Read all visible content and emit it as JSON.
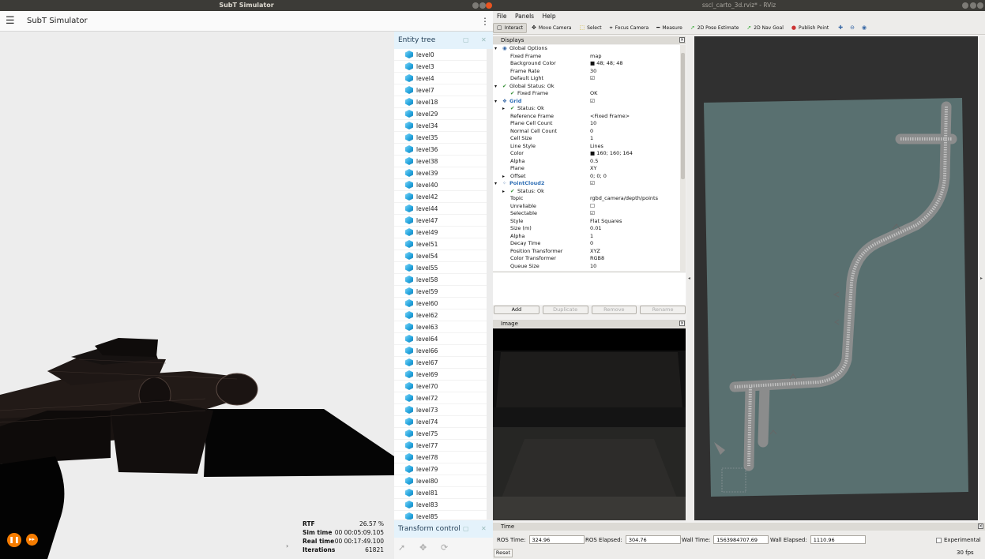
{
  "sim": {
    "window_title": "SubT Simulator",
    "app_title": "SubT Simulator",
    "menu_icon": "hamburger-menu-icon",
    "overflow_icon": "kebab-menu-icon",
    "entity_tree": {
      "title": "Entity tree",
      "items": [
        "level0",
        "level3",
        "level4",
        "level7",
        "level18",
        "level29",
        "level34",
        "level35",
        "level36",
        "level38",
        "level39",
        "level40",
        "level42",
        "level44",
        "level47",
        "level49",
        "level51",
        "level54",
        "level55",
        "level58",
        "level59",
        "level60",
        "level62",
        "level63",
        "level64",
        "level66",
        "level67",
        "level69",
        "level70",
        "level72",
        "level73",
        "level74",
        "level75",
        "level77",
        "level78",
        "level79",
        "level80",
        "level81",
        "level83",
        "level85"
      ]
    },
    "transform_control": {
      "title": "Transform control"
    },
    "stats": [
      {
        "label": "RTF",
        "value": "26.57 %"
      },
      {
        "label": "Sim time",
        "value": "00 00:05:09.105"
      },
      {
        "label": "Real time",
        "value": "00 00:17:49.100"
      },
      {
        "label": "Iterations",
        "value": "61821"
      }
    ],
    "accent_color": "#f57c00"
  },
  "rviz": {
    "window_title": "sscl_carto_3d.rviz* - RViz",
    "menu": [
      "File",
      "Panels",
      "Help"
    ],
    "toolbar": [
      {
        "label": "Interact",
        "icon": "interact-icon",
        "active": true
      },
      {
        "label": "Move Camera",
        "icon": "move-camera-icon",
        "active": false
      },
      {
        "label": "Select",
        "icon": "select-icon",
        "active": false
      },
      {
        "label": "Focus Camera",
        "icon": "focus-camera-icon",
        "active": false
      },
      {
        "label": "Measure",
        "icon": "measure-icon",
        "active": false
      },
      {
        "label": "2D Pose Estimate",
        "icon": "pose-estimate-icon",
        "active": false
      },
      {
        "label": "2D Nav Goal",
        "icon": "nav-goal-icon",
        "active": false
      },
      {
        "label": "Publish Point",
        "icon": "publish-point-icon",
        "active": false
      }
    ],
    "displays": {
      "title": "Displays",
      "rows": [
        {
          "indent": 0,
          "arrow": "▾",
          "icon": "◉",
          "name": "Global Options",
          "value": "",
          "blue": false
        },
        {
          "indent": 1,
          "arrow": "",
          "icon": "",
          "name": "Fixed Frame",
          "value": "map",
          "blue": false
        },
        {
          "indent": 1,
          "arrow": "",
          "icon": "",
          "name": "Background Color",
          "value": "■ 48; 48; 48",
          "blue": false
        },
        {
          "indent": 1,
          "arrow": "",
          "icon": "",
          "name": "Frame Rate",
          "value": "30",
          "blue": false
        },
        {
          "indent": 1,
          "arrow": "",
          "icon": "",
          "name": "Default Light",
          "value": "☑",
          "blue": false
        },
        {
          "indent": 0,
          "arrow": "▾",
          "icon": "✔",
          "name": "Global Status: Ok",
          "value": "",
          "blue": false
        },
        {
          "indent": 1,
          "arrow": "",
          "icon": "✔",
          "name": "Fixed Frame",
          "value": "OK",
          "blue": false
        },
        {
          "indent": 0,
          "arrow": "▾",
          "icon": "❖",
          "name": "Grid",
          "value": "☑",
          "blue": true
        },
        {
          "indent": 1,
          "arrow": "▸",
          "icon": "✔",
          "name": "Status: Ok",
          "value": "",
          "blue": false
        },
        {
          "indent": 1,
          "arrow": "",
          "icon": "",
          "name": "Reference Frame",
          "value": "<Fixed Frame>",
          "blue": false
        },
        {
          "indent": 1,
          "arrow": "",
          "icon": "",
          "name": "Plane Cell Count",
          "value": "10",
          "blue": false
        },
        {
          "indent": 1,
          "arrow": "",
          "icon": "",
          "name": "Normal Cell Count",
          "value": "0",
          "blue": false
        },
        {
          "indent": 1,
          "arrow": "",
          "icon": "",
          "name": "Cell Size",
          "value": "1",
          "blue": false
        },
        {
          "indent": 1,
          "arrow": "",
          "icon": "",
          "name": "Line Style",
          "value": "Lines",
          "blue": false
        },
        {
          "indent": 1,
          "arrow": "",
          "icon": "",
          "name": "Color",
          "value": "■ 160; 160; 164",
          "blue": false
        },
        {
          "indent": 1,
          "arrow": "",
          "icon": "",
          "name": "Alpha",
          "value": "0.5",
          "blue": false
        },
        {
          "indent": 1,
          "arrow": "",
          "icon": "",
          "name": "Plane",
          "value": "XY",
          "blue": false
        },
        {
          "indent": 1,
          "arrow": "▸",
          "icon": "",
          "name": "Offset",
          "value": "0; 0; 0",
          "blue": false
        },
        {
          "indent": 0,
          "arrow": "▾",
          "icon": "⁘",
          "name": "PointCloud2",
          "value": "☑",
          "blue": true
        },
        {
          "indent": 1,
          "arrow": "▸",
          "icon": "✔",
          "name": "Status: Ok",
          "value": "",
          "blue": false
        },
        {
          "indent": 1,
          "arrow": "",
          "icon": "",
          "name": "Topic",
          "value": "rgbd_camera/depth/points",
          "blue": false
        },
        {
          "indent": 1,
          "arrow": "",
          "icon": "",
          "name": "Unreliable",
          "value": "☐",
          "blue": false
        },
        {
          "indent": 1,
          "arrow": "",
          "icon": "",
          "name": "Selectable",
          "value": "☑",
          "blue": false
        },
        {
          "indent": 1,
          "arrow": "",
          "icon": "",
          "name": "Style",
          "value": "Flat Squares",
          "blue": false
        },
        {
          "indent": 1,
          "arrow": "",
          "icon": "",
          "name": "Size (m)",
          "value": "0.01",
          "blue": false
        },
        {
          "indent": 1,
          "arrow": "",
          "icon": "",
          "name": "Alpha",
          "value": "1",
          "blue": false
        },
        {
          "indent": 1,
          "arrow": "",
          "icon": "",
          "name": "Decay Time",
          "value": "0",
          "blue": false
        },
        {
          "indent": 1,
          "arrow": "",
          "icon": "",
          "name": "Position Transformer",
          "value": "XYZ",
          "blue": false
        },
        {
          "indent": 1,
          "arrow": "",
          "icon": "",
          "name": "Color Transformer",
          "value": "RGB8",
          "blue": false
        },
        {
          "indent": 1,
          "arrow": "",
          "icon": "",
          "name": "Queue Size",
          "value": "10",
          "blue": false
        }
      ],
      "buttons": {
        "add": "Add",
        "duplicate": "Duplicate",
        "remove": "Remove",
        "rename": "Rename"
      }
    },
    "image_panel": {
      "title": "Image"
    },
    "time_panel": {
      "title": "Time",
      "ros_time_label": "ROS Time:",
      "ros_time": "324.96",
      "ros_elapsed_label": "ROS Elapsed:",
      "ros_elapsed": "304.76",
      "wall_time_label": "Wall Time:",
      "wall_time": "1563984707.69",
      "wall_elapsed_label": "Wall Elapsed:",
      "wall_elapsed": "1110.96",
      "experimental_label": "Experimental",
      "reset_label": "Reset",
      "fps": "30 fps"
    }
  }
}
